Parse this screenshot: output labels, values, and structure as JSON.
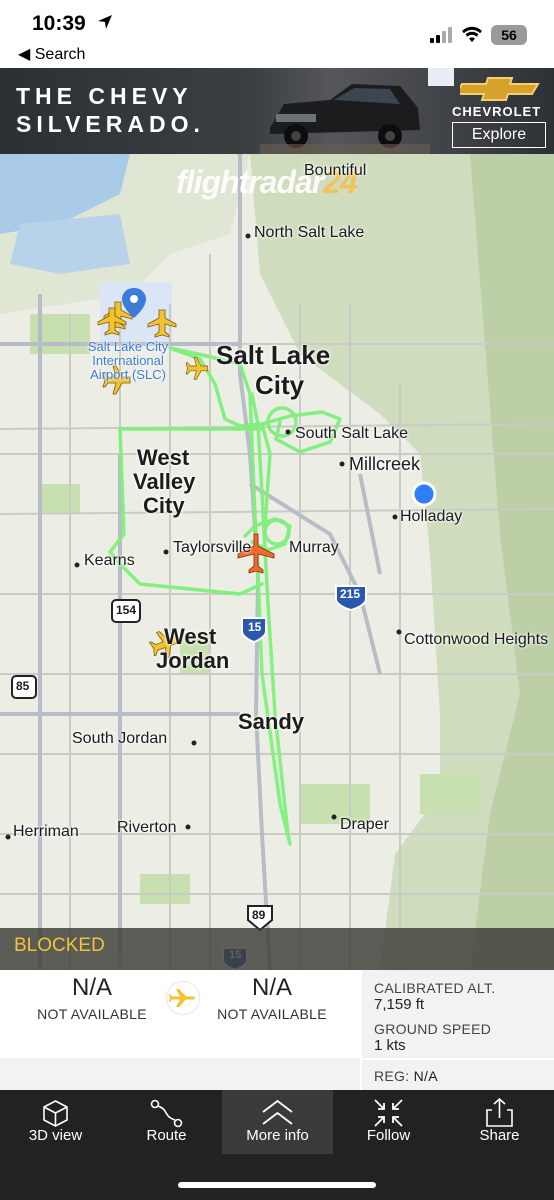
{
  "status_bar": {
    "time": "10:39",
    "back_label": "◀ Search",
    "battery": "56"
  },
  "ad": {
    "headline_line1": "THE CHEVY",
    "headline_line2": "SILVERADO.",
    "brand": "CHEVROLET",
    "cta": "Explore"
  },
  "map": {
    "logo_main": "flightradar",
    "logo_suffix": "24",
    "labels": {
      "bountiful": "Bountiful",
      "north_salt_lake": "North Salt Lake",
      "salt_lake_city_1": "Salt Lake",
      "salt_lake_city_2": "City",
      "airport_1": "Salt Lake City",
      "airport_2": "International",
      "airport_3": "Airport (SLC)",
      "south_salt_lake": "South Salt Lake",
      "millcreek": "Millcreek",
      "holladay": "Holladay",
      "west_valley_1": "West",
      "west_valley_2": "Valley",
      "west_valley_3": "City",
      "kearns": "Kearns",
      "taylorsville": "Taylorsville",
      "murray": "Murray",
      "cottonwood": "Cottonwood Heights",
      "west_jordan_1": "West",
      "west_jordan_2": "Jordan",
      "sandy": "Sandy",
      "south_jordan": "South Jordan",
      "herriman": "Herriman",
      "riverton": "Riverton",
      "draper": "Draper"
    },
    "shields": {
      "i215": "215",
      "i15_upper": "15",
      "i15_lower": "15",
      "sr154": "154",
      "sr85": "85",
      "us89": "89"
    },
    "colors": {
      "track": "#7ef07a",
      "selected_plane": "#ef6b2a",
      "other_planes": "#f2c230"
    }
  },
  "blocked_bar": {
    "text": "BLOCKED"
  },
  "info": {
    "origin_code": "N/A",
    "origin_name": "NOT AVAILABLE",
    "dest_code": "N/A",
    "dest_name": "NOT AVAILABLE",
    "calibrated_alt_label": "CALIBRATED ALT.",
    "calibrated_alt_value": "7,159 ft",
    "ground_speed_label": "GROUND SPEED",
    "ground_speed_value": "1 kts",
    "reg_label": "REG:",
    "reg_value": "N/A"
  },
  "tabs": [
    {
      "label": "3D view",
      "icon": "cube-icon"
    },
    {
      "label": "Route",
      "icon": "route-icon"
    },
    {
      "label": "More info",
      "icon": "chevrons-up-icon"
    },
    {
      "label": "Follow",
      "icon": "follow-icon"
    },
    {
      "label": "Share",
      "icon": "share-icon"
    }
  ]
}
